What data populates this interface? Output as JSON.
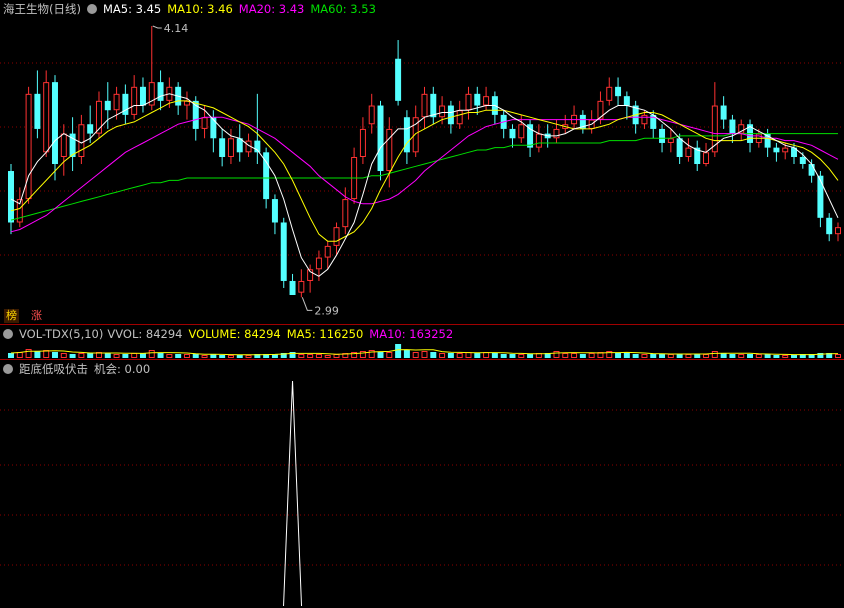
{
  "header": {
    "stock_name": "海王生物(日线)",
    "ma5": "MA5: 3.45",
    "ma10": "MA10: 3.46",
    "ma20": "MA20: 3.43",
    "ma60": "MA60: 3.53"
  },
  "tags": [
    "榜",
    "涨"
  ],
  "volume_header": {
    "name": "VOL-TDX(5,10)",
    "vvol": "VVOL: 84294",
    "volume": "VOLUME: 84294",
    "ma5": "MA5: 116250",
    "ma10": "MA10: 163252"
  },
  "signal_header": {
    "name": "距底低吸伏击",
    "value": "机会: 0.00"
  },
  "colors": {
    "up": "#ff3232",
    "down": "#54ffff",
    "ma5": "#ffffff",
    "ma10": "#ffff00",
    "ma20": "#ff00ff",
    "ma60": "#00e000",
    "grid": "#8b0000"
  },
  "chart_data": [
    {
      "type": "candlestick",
      "price_range": [
        2.99,
        4.14
      ],
      "annotations": [
        {
          "label": "4.14",
          "value": 4.14
        },
        {
          "label": "2.99",
          "value": 2.99
        }
      ],
      "series": [
        {
          "name": "MA5",
          "last": 3.45
        },
        {
          "name": "MA10",
          "last": 3.46
        },
        {
          "name": "MA20",
          "last": 3.43
        },
        {
          "name": "MA60",
          "last": 3.53
        }
      ],
      "candles": [
        [
          3.52,
          3.3,
          3.55,
          3.25
        ],
        [
          3.3,
          3.4,
          3.45,
          3.28
        ],
        [
          3.4,
          3.85,
          3.88,
          3.38
        ],
        [
          3.85,
          3.7,
          3.95,
          3.66
        ],
        [
          3.6,
          3.9,
          3.95,
          3.58
        ],
        [
          3.9,
          3.55,
          3.93,
          3.48
        ],
        [
          3.58,
          3.68,
          3.72,
          3.5
        ],
        [
          3.68,
          3.58,
          3.75,
          3.52
        ],
        [
          3.58,
          3.72,
          3.76,
          3.55
        ],
        [
          3.72,
          3.68,
          3.8,
          3.64
        ],
        [
          3.68,
          3.82,
          3.86,
          3.66
        ],
        [
          3.82,
          3.78,
          3.9,
          3.7
        ],
        [
          3.78,
          3.85,
          3.88,
          3.74
        ],
        [
          3.85,
          3.76,
          3.89,
          3.72
        ],
        [
          3.76,
          3.88,
          3.93,
          3.74
        ],
        [
          3.88,
          3.8,
          3.92,
          3.77
        ],
        [
          3.8,
          3.9,
          4.14,
          3.78
        ],
        [
          3.9,
          3.82,
          3.95,
          3.78
        ],
        [
          3.82,
          3.88,
          3.92,
          3.79
        ],
        [
          3.88,
          3.8,
          3.9,
          3.76
        ],
        [
          3.8,
          3.82,
          3.86,
          3.74
        ],
        [
          3.82,
          3.7,
          3.84,
          3.65
        ],
        [
          3.7,
          3.75,
          3.8,
          3.66
        ],
        [
          3.75,
          3.66,
          3.78,
          3.6
        ],
        [
          3.66,
          3.58,
          3.7,
          3.54
        ],
        [
          3.58,
          3.66,
          3.7,
          3.55
        ],
        [
          3.66,
          3.6,
          3.72,
          3.56
        ],
        [
          3.6,
          3.65,
          3.68,
          3.58
        ],
        [
          3.65,
          3.6,
          3.85,
          3.55
        ],
        [
          3.6,
          3.4,
          3.62,
          3.36
        ],
        [
          3.4,
          3.3,
          3.42,
          3.25
        ],
        [
          3.3,
          3.05,
          3.32,
          3.02
        ],
        [
          3.05,
          2.99,
          3.08,
          2.99
        ],
        [
          3.0,
          3.05,
          3.1,
          2.98
        ],
        [
          3.05,
          3.1,
          3.12,
          3.0
        ],
        [
          3.1,
          3.15,
          3.18,
          3.05
        ],
        [
          3.15,
          3.2,
          3.22,
          3.1
        ],
        [
          3.2,
          3.28,
          3.3,
          3.16
        ],
        [
          3.28,
          3.4,
          3.45,
          3.25
        ],
        [
          3.4,
          3.58,
          3.62,
          3.38
        ],
        [
          3.58,
          3.7,
          3.75,
          3.55
        ],
        [
          3.72,
          3.8,
          3.85,
          3.68
        ],
        [
          3.8,
          3.52,
          3.82,
          3.48
        ],
        [
          3.52,
          3.7,
          3.75,
          3.45
        ],
        [
          4.0,
          3.82,
          4.08,
          3.8
        ],
        [
          3.75,
          3.6,
          3.78,
          3.55
        ],
        [
          3.6,
          3.75,
          3.8,
          3.58
        ],
        [
          3.75,
          3.85,
          3.88,
          3.7
        ],
        [
          3.85,
          3.75,
          3.88,
          3.72
        ],
        [
          3.75,
          3.8,
          3.84,
          3.72
        ],
        [
          3.8,
          3.72,
          3.82,
          3.68
        ],
        [
          3.72,
          3.78,
          3.82,
          3.7
        ],
        [
          3.78,
          3.85,
          3.88,
          3.74
        ],
        [
          3.85,
          3.8,
          3.88,
          3.76
        ],
        [
          3.8,
          3.84,
          3.88,
          3.78
        ],
        [
          3.84,
          3.76,
          3.86,
          3.72
        ],
        [
          3.76,
          3.7,
          3.78,
          3.66
        ],
        [
          3.7,
          3.66,
          3.72,
          3.62
        ],
        [
          3.66,
          3.72,
          3.76,
          3.64
        ],
        [
          3.72,
          3.62,
          3.74,
          3.58
        ],
        [
          3.62,
          3.68,
          3.72,
          3.6
        ],
        [
          3.68,
          3.66,
          3.72,
          3.62
        ],
        [
          3.66,
          3.7,
          3.74,
          3.64
        ],
        [
          3.7,
          3.72,
          3.76,
          3.68
        ],
        [
          3.72,
          3.76,
          3.8,
          3.7
        ],
        [
          3.76,
          3.7,
          3.78,
          3.68
        ],
        [
          3.7,
          3.74,
          3.78,
          3.68
        ],
        [
          3.74,
          3.82,
          3.86,
          3.72
        ],
        [
          3.82,
          3.88,
          3.92,
          3.8
        ],
        [
          3.88,
          3.84,
          3.92,
          3.8
        ],
        [
          3.84,
          3.8,
          3.86,
          3.74
        ],
        [
          3.8,
          3.72,
          3.82,
          3.68
        ],
        [
          3.72,
          3.76,
          3.78,
          3.7
        ],
        [
          3.76,
          3.7,
          3.78,
          3.66
        ],
        [
          3.7,
          3.64,
          3.72,
          3.6
        ],
        [
          3.64,
          3.66,
          3.7,
          3.6
        ],
        [
          3.66,
          3.58,
          3.68,
          3.55
        ],
        [
          3.58,
          3.62,
          3.66,
          3.56
        ],
        [
          3.62,
          3.55,
          3.65,
          3.52
        ],
        [
          3.55,
          3.6,
          3.64,
          3.54
        ],
        [
          3.6,
          3.8,
          3.9,
          3.58
        ],
        [
          3.8,
          3.74,
          3.84,
          3.7
        ],
        [
          3.74,
          3.68,
          3.76,
          3.64
        ],
        [
          3.68,
          3.72,
          3.74,
          3.65
        ],
        [
          3.72,
          3.64,
          3.74,
          3.6
        ],
        [
          3.64,
          3.68,
          3.7,
          3.62
        ],
        [
          3.68,
          3.62,
          3.7,
          3.58
        ],
        [
          3.62,
          3.6,
          3.64,
          3.56
        ],
        [
          3.6,
          3.62,
          3.64,
          3.57
        ],
        [
          3.62,
          3.58,
          3.64,
          3.55
        ],
        [
          3.58,
          3.55,
          3.6,
          3.53
        ],
        [
          3.55,
          3.5,
          3.57,
          3.47
        ],
        [
          3.5,
          3.32,
          3.52,
          3.28
        ],
        [
          3.32,
          3.25,
          3.34,
          3.22
        ],
        [
          3.25,
          3.28,
          3.3,
          3.22
        ]
      ],
      "ma5": [
        3.4,
        3.38,
        3.5,
        3.56,
        3.6,
        3.65,
        3.68,
        3.66,
        3.64,
        3.66,
        3.7,
        3.74,
        3.76,
        3.78,
        3.8,
        3.8,
        3.82,
        3.84,
        3.85,
        3.84,
        3.83,
        3.8,
        3.78,
        3.74,
        3.7,
        3.67,
        3.66,
        3.63,
        3.61,
        3.56,
        3.5,
        3.4,
        3.27,
        3.15,
        3.09,
        3.07,
        3.1,
        3.16,
        3.23,
        3.3,
        3.42,
        3.55,
        3.62,
        3.66,
        3.7,
        3.7,
        3.72,
        3.75,
        3.76,
        3.77,
        3.77,
        3.78,
        3.78,
        3.79,
        3.8,
        3.8,
        3.78,
        3.75,
        3.73,
        3.7,
        3.68,
        3.67,
        3.67,
        3.68,
        3.7,
        3.71,
        3.72,
        3.75,
        3.78,
        3.8,
        3.8,
        3.79,
        3.78,
        3.76,
        3.73,
        3.7,
        3.66,
        3.63,
        3.61,
        3.6,
        3.63,
        3.66,
        3.67,
        3.69,
        3.71,
        3.69,
        3.67,
        3.65,
        3.63,
        3.62,
        3.59,
        3.55,
        3.48,
        3.4,
        3.32
      ],
      "ma10": [
        3.35,
        3.36,
        3.4,
        3.44,
        3.48,
        3.52,
        3.56,
        3.59,
        3.61,
        3.63,
        3.66,
        3.69,
        3.71,
        3.72,
        3.73,
        3.75,
        3.77,
        3.79,
        3.81,
        3.82,
        3.82,
        3.81,
        3.8,
        3.79,
        3.77,
        3.75,
        3.73,
        3.71,
        3.68,
        3.64,
        3.6,
        3.55,
        3.48,
        3.4,
        3.32,
        3.25,
        3.22,
        3.22,
        3.24,
        3.26,
        3.3,
        3.36,
        3.44,
        3.51,
        3.58,
        3.64,
        3.68,
        3.7,
        3.72,
        3.74,
        3.75,
        3.76,
        3.77,
        3.77,
        3.78,
        3.78,
        3.78,
        3.77,
        3.76,
        3.75,
        3.74,
        3.73,
        3.72,
        3.71,
        3.7,
        3.7,
        3.7,
        3.71,
        3.72,
        3.74,
        3.75,
        3.76,
        3.77,
        3.77,
        3.76,
        3.74,
        3.72,
        3.7,
        3.68,
        3.66,
        3.65,
        3.65,
        3.65,
        3.65,
        3.66,
        3.66,
        3.66,
        3.65,
        3.64,
        3.63,
        3.62,
        3.6,
        3.57,
        3.53,
        3.48
      ],
      "ma20": [
        3.26,
        3.27,
        3.29,
        3.31,
        3.33,
        3.36,
        3.39,
        3.42,
        3.45,
        3.48,
        3.51,
        3.54,
        3.57,
        3.6,
        3.62,
        3.64,
        3.66,
        3.68,
        3.7,
        3.72,
        3.73,
        3.74,
        3.75,
        3.75,
        3.75,
        3.74,
        3.73,
        3.72,
        3.7,
        3.68,
        3.66,
        3.63,
        3.6,
        3.57,
        3.54,
        3.5,
        3.47,
        3.44,
        3.41,
        3.39,
        3.38,
        3.38,
        3.39,
        3.4,
        3.42,
        3.45,
        3.48,
        3.52,
        3.55,
        3.58,
        3.61,
        3.64,
        3.67,
        3.69,
        3.71,
        3.72,
        3.73,
        3.74,
        3.74,
        3.74,
        3.74,
        3.74,
        3.74,
        3.74,
        3.74,
        3.74,
        3.74,
        3.74,
        3.74,
        3.74,
        3.75,
        3.75,
        3.75,
        3.75,
        3.74,
        3.73,
        3.72,
        3.71,
        3.7,
        3.69,
        3.68,
        3.68,
        3.68,
        3.68,
        3.67,
        3.67,
        3.66,
        3.66,
        3.65,
        3.65,
        3.64,
        3.63,
        3.61,
        3.59,
        3.57
      ],
      "ma60": [
        3.31,
        3.32,
        3.33,
        3.34,
        3.35,
        3.36,
        3.37,
        3.38,
        3.39,
        3.4,
        3.41,
        3.42,
        3.43,
        3.44,
        3.45,
        3.46,
        3.47,
        3.47,
        3.48,
        3.48,
        3.49,
        3.49,
        3.49,
        3.49,
        3.49,
        3.49,
        3.49,
        3.49,
        3.49,
        3.49,
        3.49,
        3.49,
        3.49,
        3.49,
        3.49,
        3.49,
        3.49,
        3.49,
        3.49,
        3.49,
        3.49,
        3.5,
        3.5,
        3.51,
        3.52,
        3.53,
        3.54,
        3.55,
        3.56,
        3.57,
        3.58,
        3.59,
        3.6,
        3.61,
        3.61,
        3.62,
        3.62,
        3.63,
        3.63,
        3.63,
        3.64,
        3.64,
        3.64,
        3.64,
        3.64,
        3.64,
        3.64,
        3.64,
        3.65,
        3.65,
        3.65,
        3.65,
        3.66,
        3.66,
        3.66,
        3.66,
        3.67,
        3.67,
        3.67,
        3.67,
        3.67,
        3.67,
        3.68,
        3.68,
        3.68,
        3.68,
        3.68,
        3.68,
        3.68,
        3.68,
        3.68,
        3.68,
        3.68,
        3.68,
        3.68
      ]
    },
    {
      "type": "bar",
      "title": "VOL-TDX(5,10)",
      "values": [
        5,
        6,
        9,
        7,
        8,
        6,
        5,
        4,
        5,
        5,
        6,
        5,
        4,
        4,
        5,
        5,
        8,
        5,
        4,
        4,
        4,
        4,
        3,
        4,
        3,
        3,
        3,
        3,
        4,
        4,
        4,
        5,
        6,
        4,
        4,
        4,
        3,
        4,
        5,
        6,
        7,
        8,
        6,
        6,
        14,
        8,
        6,
        7,
        6,
        5,
        5,
        5,
        6,
        5,
        6,
        5,
        4,
        4,
        4,
        4,
        5,
        5,
        7,
        5,
        5,
        4,
        5,
        6,
        7,
        5,
        5,
        4,
        4,
        4,
        4,
        4,
        4,
        4,
        4,
        4,
        7,
        5,
        4,
        4,
        4,
        4,
        4,
        3,
        3,
        3,
        4,
        4,
        5,
        5,
        4
      ]
    },
    {
      "type": "line",
      "title": "距底低吸伏击",
      "peak_index": 32,
      "values": "0 everywhere except a spike to 1 at index 32"
    }
  ]
}
